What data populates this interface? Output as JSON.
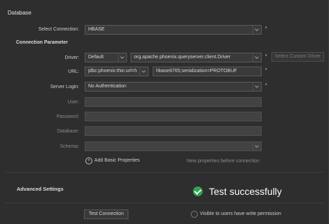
{
  "database": {
    "section_title": "Database",
    "select_connection_label": "Select Connection:",
    "select_connection_value": "HBASE",
    "connection_parameter_label": "Connection Parameter",
    "driver_label": "Driver:",
    "driver_mode_value": "Default",
    "driver_class_value": "org.apache.phoenix.queryserver.client.Driver",
    "select_custom_driver_label": "Select Custom Driver",
    "url_label": "URL:",
    "url_prefix_value": "jdbc:phoenix:thin:url=h",
    "url_suffix_value": "hbase8765;serialization=PROTOBUF",
    "server_login_label": "Server Login:",
    "server_login_value": "No Authentication",
    "user_label": "User:",
    "password_label": "Password:",
    "database_label": "Database:",
    "schema_label": "Schema:",
    "add_basic_properties_label": "Add Basic Properties",
    "new_properties_hint": "New properties before connection",
    "required_mark": "*"
  },
  "advanced": {
    "section_title": "Advanced Settings"
  },
  "footer": {
    "test_connection_label": "Test Connection",
    "visible_to_users_label": "Visible to users have write permission"
  },
  "toast": {
    "message": "Test successfully",
    "icon": "check-circle-icon",
    "color": "#2aa84a"
  }
}
